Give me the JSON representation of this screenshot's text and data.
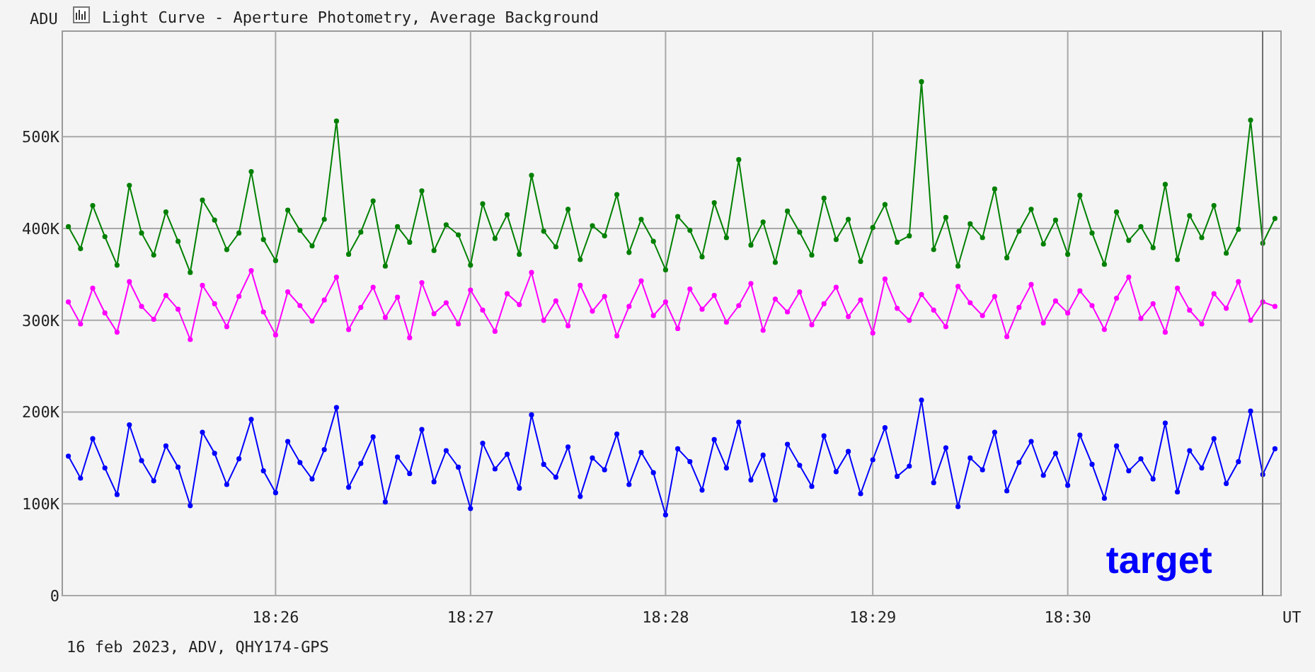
{
  "window": {
    "title": "Light Curve - Aperture Photometry, Average Background"
  },
  "plot": {
    "chart_data": {
      "type": "line",
      "xlabel": "UT",
      "ylabel": "ADU",
      "grid": true,
      "ylim": [
        0,
        615
      ],
      "categories": [
        null,
        null,
        null,
        null,
        null,
        null,
        null,
        null,
        null,
        null,
        null,
        null,
        null,
        null,
        null,
        null,
        null,
        "18:26",
        null,
        null,
        null,
        null,
        null,
        null,
        null,
        null,
        null,
        null,
        null,
        null,
        null,
        null,
        null,
        "18:27",
        null,
        null,
        null,
        null,
        null,
        null,
        null,
        null,
        null,
        null,
        null,
        null,
        null,
        null,
        null,
        "18:28",
        null,
        null,
        null,
        null,
        null,
        null,
        null,
        null,
        null,
        null,
        null,
        null,
        null,
        null,
        null,
        null,
        "18:29",
        null,
        null,
        null,
        null,
        null,
        null,
        null,
        null,
        null,
        null,
        null,
        null,
        null,
        null,
        null,
        "18:30",
        null,
        null,
        null,
        null,
        null,
        null,
        null,
        null,
        null,
        null,
        null,
        null,
        null,
        null,
        null,
        null,
        null
      ],
      "yticks": [
        {
          "value": 500,
          "label": "500K"
        },
        {
          "value": 400,
          "label": "400K"
        },
        {
          "value": 300,
          "label": "300K"
        },
        {
          "value": 200,
          "label": "200K"
        },
        {
          "value": 100,
          "label": "100K"
        },
        {
          "value": 0,
          "label": "0"
        }
      ],
      "series": [
        {
          "color": "#008000",
          "marker": "circle",
          "values": [
            402,
            378,
            425,
            391,
            360,
            447,
            395,
            371,
            418,
            386,
            352,
            431,
            409,
            377,
            395,
            462,
            388,
            365,
            420,
            398,
            381,
            410,
            517,
            372,
            396,
            430,
            359,
            402,
            385,
            441,
            376,
            404,
            393,
            360,
            427,
            389,
            415,
            372,
            458,
            397,
            380,
            421,
            366,
            403,
            392,
            437,
            374,
            410,
            386,
            355,
            413,
            398,
            369,
            428,
            390,
            475,
            382,
            407,
            363,
            419,
            396,
            371,
            433,
            388,
            410,
            364,
            401,
            426,
            385,
            392,
            560,
            377,
            412,
            359,
            405,
            390,
            443,
            368,
            397,
            421,
            383,
            409,
            372,
            436,
            395,
            361,
            418,
            387,
            402,
            379,
            448,
            366,
            414,
            390,
            425,
            373,
            399,
            518,
            384,
            411
          ]
        },
        {
          "color": "#ff00ff",
          "marker": "circle",
          "values": [
            320,
            296,
            335,
            308,
            287,
            342,
            315,
            301,
            327,
            312,
            279,
            338,
            318,
            293,
            326,
            354,
            309,
            284,
            331,
            316,
            299,
            322,
            347,
            290,
            314,
            336,
            303,
            325,
            281,
            341,
            307,
            319,
            296,
            333,
            311,
            288,
            329,
            317,
            352,
            300,
            321,
            294,
            338,
            310,
            326,
            283,
            315,
            343,
            305,
            320,
            291,
            334,
            312,
            327,
            298,
            316,
            340,
            289,
            323,
            309,
            331,
            295,
            318,
            336,
            304,
            322,
            286,
            345,
            313,
            300,
            328,
            311,
            293,
            337,
            319,
            305,
            326,
            282,
            314,
            339,
            297,
            321,
            308,
            332,
            316,
            290,
            324,
            347,
            302,
            318,
            287,
            335,
            311,
            296,
            329,
            313,
            342,
            300,
            320,
            315
          ]
        },
        {
          "name": "target",
          "color": "#0000ff",
          "marker": "circle",
          "values": [
            152,
            128,
            171,
            139,
            110,
            186,
            147,
            125,
            163,
            140,
            98,
            178,
            155,
            121,
            149,
            192,
            136,
            112,
            168,
            145,
            127,
            159,
            205,
            118,
            144,
            173,
            102,
            151,
            133,
            181,
            124,
            158,
            140,
            95,
            166,
            138,
            154,
            117,
            197,
            143,
            129,
            162,
            108,
            150,
            137,
            176,
            121,
            156,
            134,
            88,
            160,
            146,
            115,
            170,
            139,
            189,
            126,
            153,
            104,
            165,
            142,
            119,
            174,
            135,
            157,
            111,
            148,
            183,
            130,
            141,
            213,
            123,
            161,
            97,
            150,
            137,
            178,
            114,
            145,
            168,
            131,
            155,
            120,
            175,
            143,
            106,
            163,
            136,
            149,
            127,
            188,
            113,
            158,
            139,
            171,
            122,
            146,
            201,
            132,
            160
          ]
        }
      ]
    }
  },
  "footer": "16 feb 2023, ADV, QHY174-GPS"
}
